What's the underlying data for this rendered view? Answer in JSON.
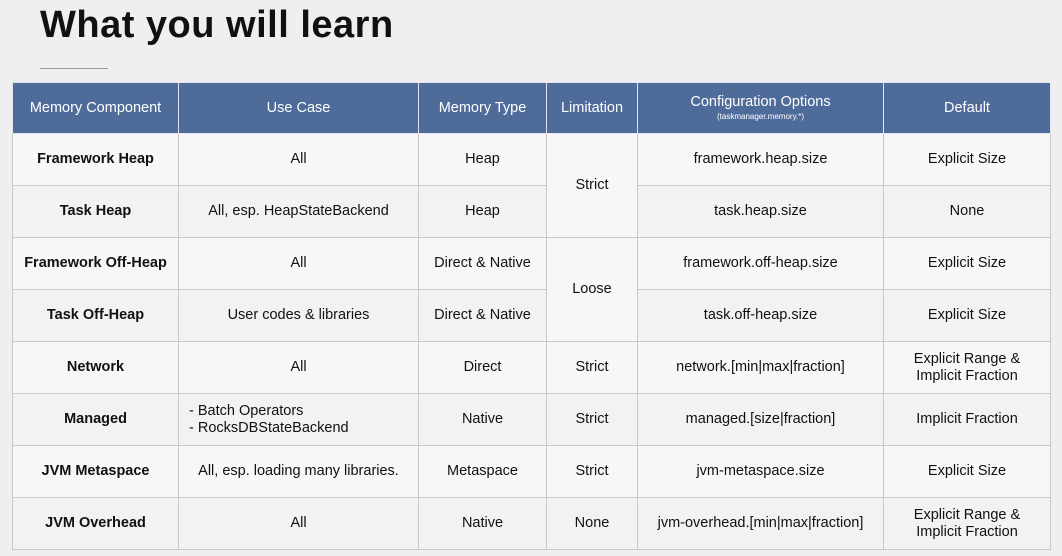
{
  "title": "What you will learn",
  "table": {
    "headers": {
      "component": "Memory Component",
      "use_case": "Use Case",
      "memory_type": "Memory Type",
      "limitation": "Limitation",
      "config": "Configuration Options",
      "config_sub": "(taskmanager.memory.*)",
      "default": "Default"
    },
    "rows": [
      {
        "component": "Framework Heap",
        "use_case": "All",
        "memory_type": "Heap",
        "limitation": "Strict",
        "config": "framework.heap.size",
        "default": "Explicit Size"
      },
      {
        "component": "Task Heap",
        "use_case": "All, esp. HeapStateBackend",
        "memory_type": "Heap",
        "config": "task.heap.size",
        "default": "None"
      },
      {
        "component": "Framework Off-Heap",
        "use_case": "All",
        "memory_type": "Direct & Native",
        "limitation": "Loose",
        "config": "framework.off-heap.size",
        "default": "Explicit Size"
      },
      {
        "component": "Task Off-Heap",
        "use_case": "User codes & libraries",
        "memory_type": "Direct & Native",
        "config": "task.off-heap.size",
        "default": "Explicit Size"
      },
      {
        "component": "Network",
        "use_case": "All",
        "memory_type": "Direct",
        "limitation": "Strict",
        "config": "network.[min|max|fraction]",
        "default_line1": "Explicit Range &",
        "default_line2": "Implicit Fraction"
      },
      {
        "component": "Managed",
        "use_case_line1": "- Batch Operators",
        "use_case_line2": "- RocksDBStateBackend",
        "memory_type": "Native",
        "limitation": "Strict",
        "config": "managed.[size|fraction]",
        "default": "Implicit Fraction"
      },
      {
        "component": "JVM Metaspace",
        "use_case": "All, esp. loading many libraries.",
        "memory_type": "Metaspace",
        "limitation": "Strict",
        "config": "jvm-metaspace.size",
        "default": "Explicit Size"
      },
      {
        "component": "JVM Overhead",
        "use_case": "All",
        "memory_type": "Native",
        "limitation": "None",
        "config": "jvm-overhead.[min|max|fraction]",
        "default_line1": "Explicit Range &",
        "default_line2": "Implicit Fraction"
      }
    ]
  }
}
